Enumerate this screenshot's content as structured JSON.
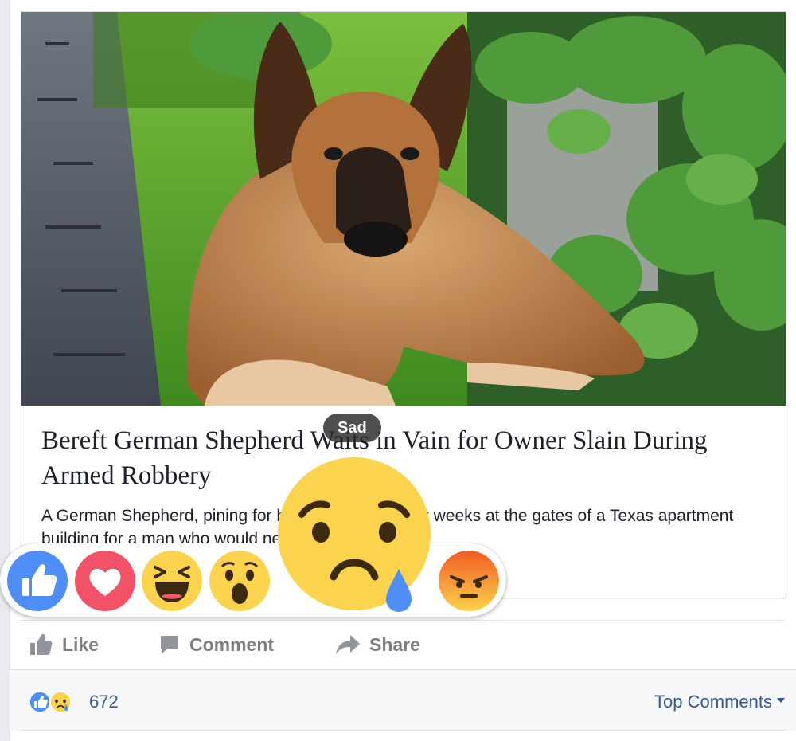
{
  "link_card": {
    "headline": "Bereft German Shepherd Waits in Vain for Owner Slain During Armed Robbery",
    "summary": "A German Shepherd, pining for his owner, waited for weeks at the gates of a Texas apartment building for a man who would never come."
  },
  "reactions": {
    "tooltip": "Sad",
    "items": [
      "like-reaction",
      "love-reaction",
      "haha-reaction",
      "wow-reaction",
      "sad-reaction",
      "angry-reaction"
    ],
    "colors": {
      "like": "#4f8ef7",
      "love": "#f25268",
      "emoji": "#fcd34d",
      "angry": "#f25b22",
      "tear": "#4f8ef7"
    }
  },
  "actions": {
    "like_label": "Like",
    "comment_label": "Comment",
    "share_label": "Share"
  },
  "stats": {
    "reaction_count": "672",
    "sort_label": "Top Comments"
  }
}
